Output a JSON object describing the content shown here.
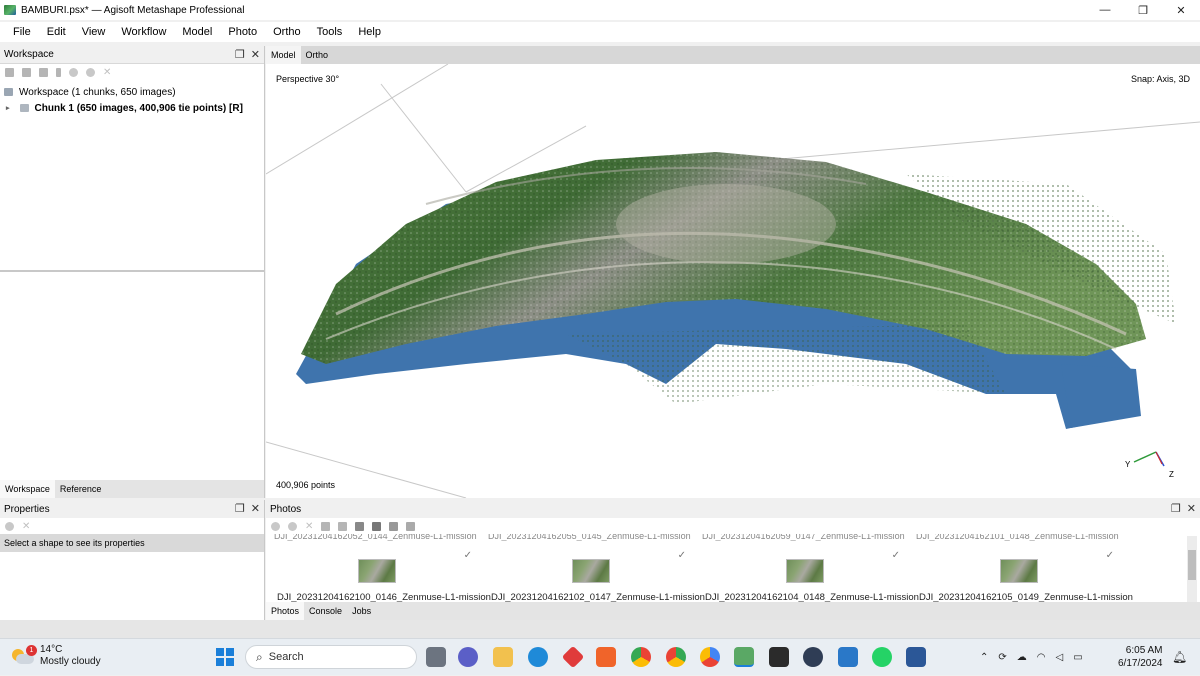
{
  "window": {
    "title": "BAMBURI.psx* — Agisoft Metashape Professional",
    "controls": {
      "minimize": "—",
      "maximize": "❐",
      "close": "✕"
    }
  },
  "menu": [
    "File",
    "Edit",
    "View",
    "Workflow",
    "Model",
    "Photo",
    "Ortho",
    "Tools",
    "Help"
  ],
  "workspace": {
    "title": "Workspace",
    "root": "Workspace (1 chunks, 650 images)",
    "chunk": "Chunk 1 (650 images, 400,906 tie points) [R]",
    "tabs": [
      "Workspace",
      "Reference"
    ]
  },
  "properties": {
    "title": "Properties",
    "message": "Select a shape to see its properties"
  },
  "view": {
    "tabs": [
      "Model",
      "Ortho"
    ],
    "projection": "Perspective 30°",
    "snap": "Snap: Axis, 3D",
    "points": "400,906 points",
    "axis_labels": {
      "y": "Y",
      "z": "Z"
    }
  },
  "photos": {
    "title": "Photos",
    "items": [
      {
        "top": "DJI_20231204162052_0144_Zenmuse-L1-mission",
        "name": "DJI_20231204162100_0146_Zenmuse-L1-mission"
      },
      {
        "top": "DJI_20231204162055_0145_Zenmuse-L1-mission",
        "name": "DJI_20231204162102_0147_Zenmuse-L1-mission"
      },
      {
        "top": "DJI_20231204162059_0147_Zenmuse-L1-mission",
        "name": "DJI_20231204162104_0148_Zenmuse-L1-mission"
      },
      {
        "top": "DJI_20231204162101_0148_Zenmuse-L1-mission",
        "name": "DJI_20231204162105_0149_Zenmuse-L1-mission"
      }
    ],
    "check": "✓",
    "tabs": [
      "Photos",
      "Console",
      "Jobs"
    ]
  },
  "taskbar": {
    "weather_temp": "14°C",
    "weather_desc": "Mostly cloudy",
    "weather_badge": "1",
    "search_placeholder": "Search",
    "time": "6:05 AM",
    "date": "6/17/2024"
  },
  "colors": {
    "cloud_green": "#3f6b35",
    "cloud_blue": "#3f74ad",
    "accent": "#1b7fd9"
  }
}
